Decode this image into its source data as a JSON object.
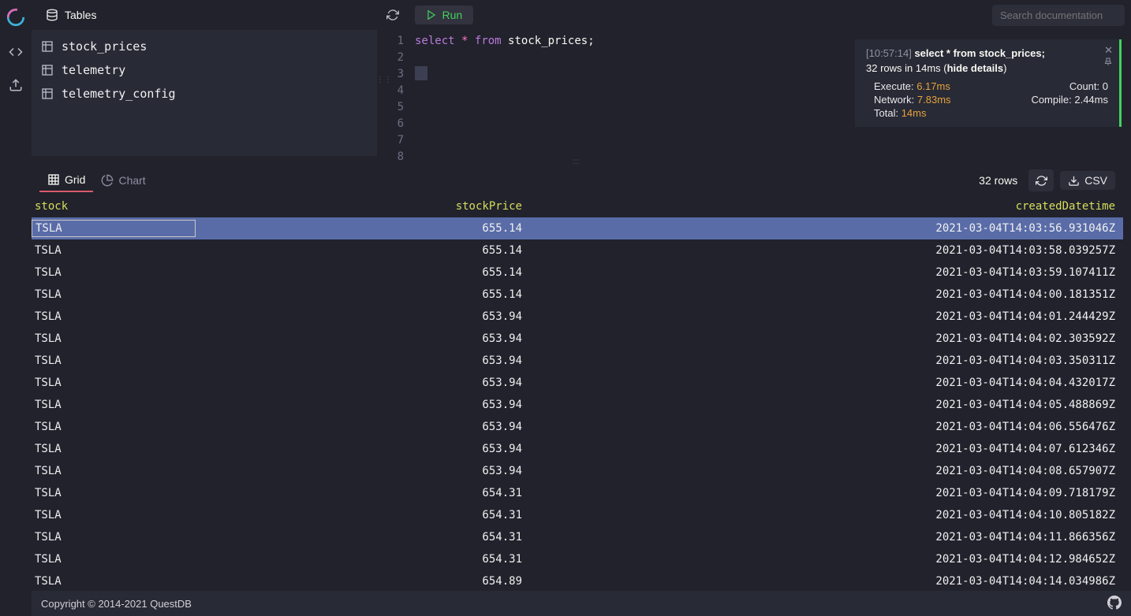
{
  "top": {
    "tables_label": "Tables",
    "run_label": "Run",
    "search_placeholder": "Search documentation"
  },
  "sidebar": {
    "tables": [
      "stock_prices",
      "telemetry",
      "telemetry_config"
    ]
  },
  "editor": {
    "line_numbers": [
      "1",
      "2",
      "3",
      "4",
      "5",
      "6",
      "7",
      "8"
    ],
    "sql": {
      "select": "select",
      "star": "*",
      "from": "from",
      "table": "stock_prices;"
    }
  },
  "notif": {
    "ts": "[10:57:14]",
    "query": "select * from stock_prices;",
    "summary_pre": "32 rows in 14ms (",
    "hide": "hide details",
    "summary_post": ")",
    "execute_lbl": "Execute:",
    "execute_val": "6.17ms",
    "count_lbl": "Count:",
    "count_val": "0",
    "network_lbl": "Network:",
    "network_val": "7.83ms",
    "compile_lbl": "Compile:",
    "compile_val": "2.44ms",
    "total_lbl": "Total:",
    "total_val": "14ms"
  },
  "results": {
    "grid_label": "Grid",
    "chart_label": "Chart",
    "count": "32 rows",
    "csv": "CSV",
    "columns": {
      "stock": "stock",
      "price": "stockPrice",
      "dt": "createdDatetime"
    },
    "rows": [
      {
        "stock": "TSLA",
        "price": "655.14",
        "dt": "2021-03-04T14:03:56.931046Z"
      },
      {
        "stock": "TSLA",
        "price": "655.14",
        "dt": "2021-03-04T14:03:58.039257Z"
      },
      {
        "stock": "TSLA",
        "price": "655.14",
        "dt": "2021-03-04T14:03:59.107411Z"
      },
      {
        "stock": "TSLA",
        "price": "655.14",
        "dt": "2021-03-04T14:04:00.181351Z"
      },
      {
        "stock": "TSLA",
        "price": "653.94",
        "dt": "2021-03-04T14:04:01.244429Z"
      },
      {
        "stock": "TSLA",
        "price": "653.94",
        "dt": "2021-03-04T14:04:02.303592Z"
      },
      {
        "stock": "TSLA",
        "price": "653.94",
        "dt": "2021-03-04T14:04:03.350311Z"
      },
      {
        "stock": "TSLA",
        "price": "653.94",
        "dt": "2021-03-04T14:04:04.432017Z"
      },
      {
        "stock": "TSLA",
        "price": "653.94",
        "dt": "2021-03-04T14:04:05.488869Z"
      },
      {
        "stock": "TSLA",
        "price": "653.94",
        "dt": "2021-03-04T14:04:06.556476Z"
      },
      {
        "stock": "TSLA",
        "price": "653.94",
        "dt": "2021-03-04T14:04:07.612346Z"
      },
      {
        "stock": "TSLA",
        "price": "653.94",
        "dt": "2021-03-04T14:04:08.657907Z"
      },
      {
        "stock": "TSLA",
        "price": "654.31",
        "dt": "2021-03-04T14:04:09.718179Z"
      },
      {
        "stock": "TSLA",
        "price": "654.31",
        "dt": "2021-03-04T14:04:10.805182Z"
      },
      {
        "stock": "TSLA",
        "price": "654.31",
        "dt": "2021-03-04T14:04:11.866356Z"
      },
      {
        "stock": "TSLA",
        "price": "654.31",
        "dt": "2021-03-04T14:04:12.984652Z"
      },
      {
        "stock": "TSLA",
        "price": "654.89",
        "dt": "2021-03-04T14:04:14.034986Z"
      }
    ]
  },
  "footer": {
    "copyright": "Copyright © 2014-2021 QuestDB"
  }
}
